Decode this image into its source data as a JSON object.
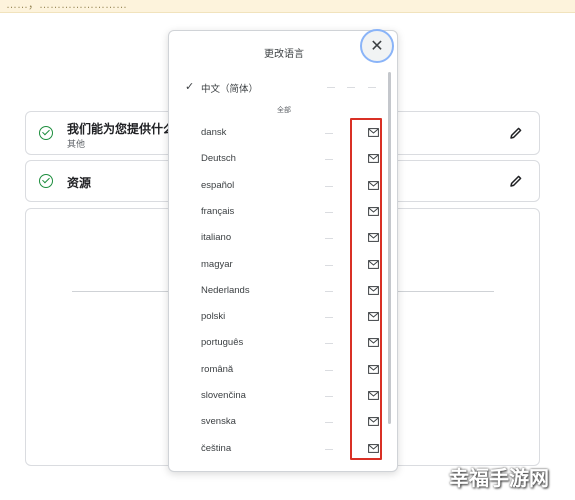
{
  "top_banner": {
    "text": "……，……………………"
  },
  "background": {
    "help_card": {
      "title": "我们能为您提供什么帮",
      "subtitle": "其他"
    },
    "resources_card": {
      "title": "资源"
    }
  },
  "dialog": {
    "title": "更改语言",
    "current": {
      "label": "中文（简体）",
      "checked": true
    },
    "section_label": "全部",
    "languages": [
      "dansk",
      "Deutsch",
      "español",
      "français",
      "italiano",
      "magyar",
      "Nederlands",
      "polski",
      "português",
      "română",
      "slovenčina",
      "svenska",
      "čeština"
    ],
    "row_icon": "mail-icon"
  },
  "colors": {
    "highlight": "#d93025",
    "check_green": "#1e8e3e",
    "close_ring": "#8ab4f8",
    "banner": "#fdf3dc"
  },
  "watermark": {
    "text": "幸福手游网"
  }
}
